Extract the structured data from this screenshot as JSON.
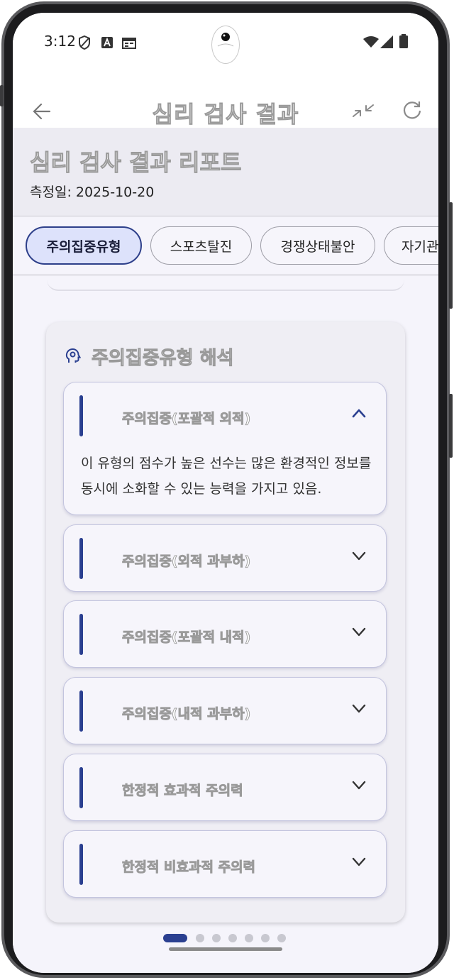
{
  "status_bar": {
    "time": "3:12",
    "icons": [
      "shield-icon",
      "a-icon",
      "calendar-icon",
      "wifi-icon",
      "signal-icon",
      "battery-icon"
    ]
  },
  "app_bar": {
    "title": "심리 검사 결과",
    "back_icon": "arrow-left-icon",
    "actions": [
      "compress-icon",
      "refresh-icon"
    ]
  },
  "report": {
    "title": "심리 검사 결과 리포트",
    "date": "측정일: 2025-10-20"
  },
  "chips": [
    {
      "label": "주의집중유형",
      "active": true
    },
    {
      "label": "스포츠탈진",
      "active": false
    },
    {
      "label": "경쟁상태불안",
      "active": false
    },
    {
      "label": "자기관",
      "active": false
    }
  ],
  "interpretation": {
    "title": "주의집중유형 해석",
    "icon": "psychology-icon",
    "items": [
      {
        "title": "주의집중(포괄적 외적)",
        "expanded": true,
        "body": "이 유형의 점수가 높은 선수는 많은 환경적인 정보를 동시에 소화할 수 있는 능력을 가지고 있음."
      },
      {
        "title": "주의집중(외적 과부하)",
        "expanded": false
      },
      {
        "title": "주의집중(포괄적 내적)",
        "expanded": false
      },
      {
        "title": "주의집중(내적 과부하)",
        "expanded": false
      },
      {
        "title": "한정적 효과적 주의력",
        "expanded": false
      },
      {
        "title": "한정적 비효과적 주의력",
        "expanded": false
      }
    ]
  },
  "pager": {
    "count": 7,
    "active_index": 0
  },
  "colors": {
    "accent": "#2a3f90",
    "chip_active_bg": "#dde2fb",
    "background": "#f5f4fb"
  }
}
